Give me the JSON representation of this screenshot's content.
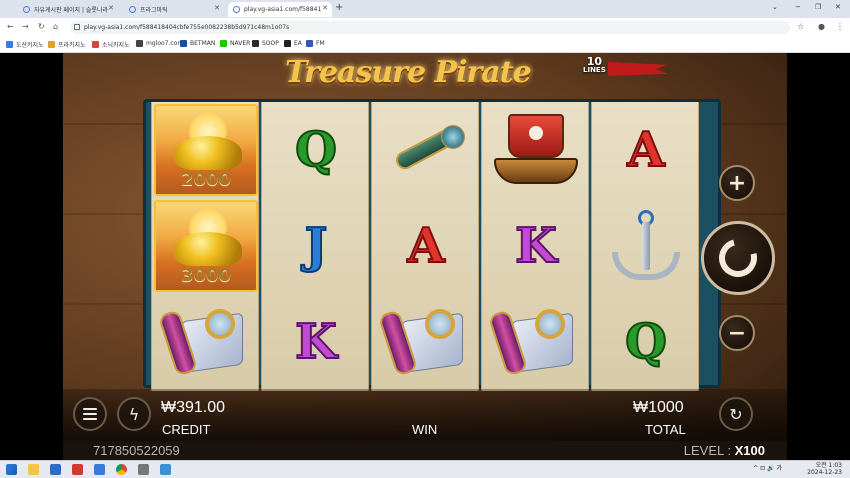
{
  "browser": {
    "tabs": [
      {
        "label": "자유게시판 페이지 | 슬롯나라",
        "active": false
      },
      {
        "label": "프라그마틱",
        "active": false
      },
      {
        "label": "play.vg-asia1.com/f58841",
        "active": true
      }
    ],
    "new_tab": "+",
    "window_controls": {
      "minimize": "−",
      "maximize": "❐",
      "close": "✕",
      "chevron": "⌄"
    },
    "url": "play.vg-asia1.com/f588418404cbfe755e0082238b5d971c48m1o07s",
    "bookmarks": [
      {
        "label": "도산카지노",
        "color": "#3b7dd8"
      },
      {
        "label": "프라카지노",
        "color": "#e0a12a"
      },
      {
        "label": "소닉카지노",
        "color": "#d04a3a"
      },
      {
        "label": "mgloo7.com",
        "color": "#444444"
      },
      {
        "label": "BETMAN",
        "color": "#1a4fa0"
      },
      {
        "label": "NAVER",
        "color": "#1ec800"
      },
      {
        "label": "SOOP",
        "color": "#2b2b2b"
      },
      {
        "label": "EA",
        "color": "#222222"
      },
      {
        "label": "FM",
        "color": "#3559b5"
      }
    ]
  },
  "game": {
    "title": "Treasure Pirate",
    "lines_number": "10",
    "lines_label": "LINES",
    "reels": [
      [
        {
          "type": "gold",
          "amount": "2000"
        },
        {
          "type": "gold",
          "amount": "3000"
        },
        {
          "type": "scroll-map"
        }
      ],
      [
        {
          "type": "letter",
          "value": "Q"
        },
        {
          "type": "letter",
          "value": "J"
        },
        {
          "type": "letter",
          "value": "K"
        }
      ],
      [
        {
          "type": "spyglass"
        },
        {
          "type": "letter",
          "value": "A"
        },
        {
          "type": "scroll-map"
        }
      ],
      [
        {
          "type": "pirate-ship"
        },
        {
          "type": "letter",
          "value": "K"
        },
        {
          "type": "scroll-map"
        }
      ],
      [
        {
          "type": "letter",
          "value": "A"
        },
        {
          "type": "anchor"
        },
        {
          "type": "letter",
          "value": "Q"
        }
      ]
    ],
    "controls": {
      "plus": "+",
      "minus": "−"
    },
    "bottom": {
      "credit_value": "₩391.00",
      "credit_label": "CREDIT",
      "win_label": "WIN",
      "total_value": "₩1000",
      "total_label": "TOTAL"
    },
    "info": {
      "session_id": "717850522059",
      "level_label": "LEVEL :",
      "level_value": "X100"
    }
  },
  "taskbar": {
    "time": "오전 1:03",
    "date": "2024-12-23",
    "tray_symbols": "^ ⊡ 🔊 가"
  }
}
